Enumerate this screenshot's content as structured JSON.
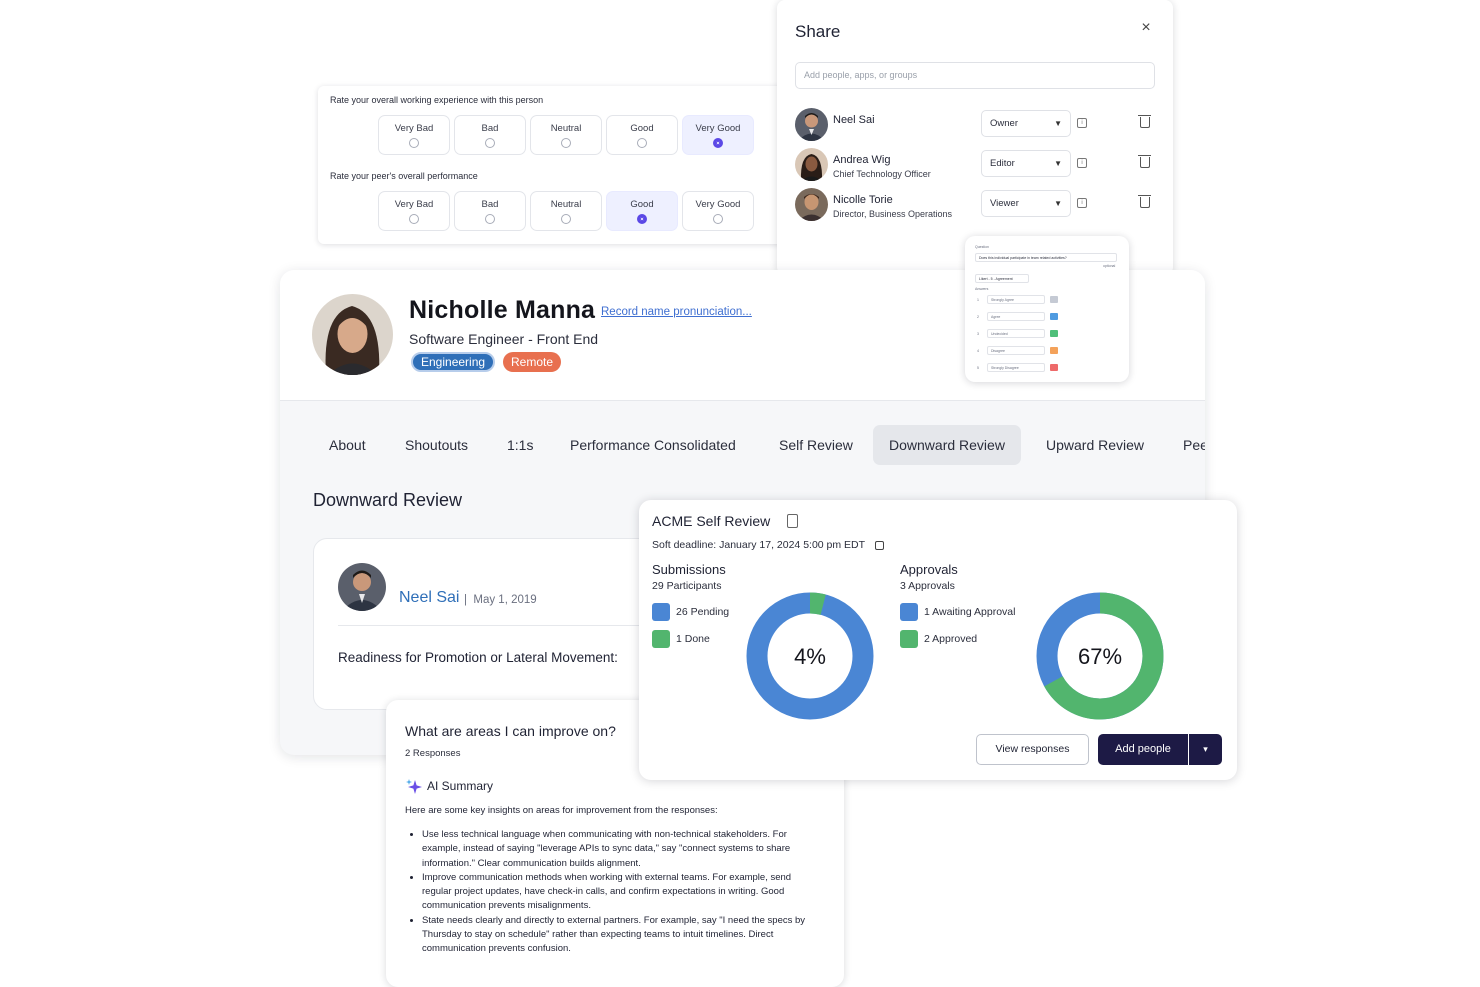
{
  "rating": {
    "questions": [
      {
        "label": "Rate your overall working experience with this person",
        "options": [
          "Very Bad",
          "Bad",
          "Neutral",
          "Good",
          "Very Good"
        ],
        "selected": 4
      },
      {
        "label": "Rate your peer's overall performance",
        "options": [
          "Very Bad",
          "Bad",
          "Neutral",
          "Good",
          "Very Good"
        ],
        "selected": 3
      }
    ]
  },
  "share": {
    "title": "Share",
    "close_icon": "close-icon",
    "placeholder": "Add people, apps, or groups",
    "people": [
      {
        "name": "Neel Sai",
        "role": "",
        "permission": "Owner"
      },
      {
        "name": "Andrea Wig",
        "role": "Chief Technology Officer",
        "permission": "Editor"
      },
      {
        "name": "Nicolle Torie",
        "role": "Director, Business Operations",
        "permission": "Viewer"
      }
    ]
  },
  "profile": {
    "name": "Nicholle Manna",
    "pronunciation_link": "Record name pronunciation...",
    "title": "Software Engineer - Front End",
    "tags": [
      "Engineering",
      "Remote"
    ],
    "tag_colors": {
      "engineering": "#2f6fb8",
      "remote": "#e8704f"
    }
  },
  "tabs": [
    "About",
    "Shoutouts",
    "1:1s",
    "Performance Consolidated",
    "Self Review",
    "Downward Review",
    "Upward Review",
    "Pee"
  ],
  "active_tab": "Downward Review",
  "section": {
    "title": "Downward Review",
    "review": {
      "reviewer": "Neel Sai",
      "separator": "|",
      "date": "May 1, 2019",
      "question": "Readiness for Promotion or Lateral Movement:"
    }
  },
  "preview": {
    "question_label": "Question",
    "question_text": "Does this individual participate in team related activities?",
    "optional": "optional",
    "scale": "Likert - 5 - Agreement",
    "answers_label": "Answers",
    "answers": [
      {
        "n": "1",
        "label": "Strongly Agree",
        "color": "#c5cad4"
      },
      {
        "n": "2",
        "label": "Agree",
        "color": "#4f9be0"
      },
      {
        "n": "3",
        "label": "Undecided",
        "color": "#4fbf7a"
      },
      {
        "n": "4",
        "label": "Disagree",
        "color": "#f4a25a"
      },
      {
        "n": "5",
        "label": "Strongly Disagree",
        "color": "#ee6a6a"
      }
    ]
  },
  "summary": {
    "title": "What are areas I can improve on?",
    "count": "2 Responses",
    "ai_label": "AI Summary",
    "intro": "Here are some key insights on areas for improvement from the responses:",
    "items": [
      "Use less technical language when communicating with non-technical stakeholders. For example, instead of saying \"leverage APIs to sync data,\" say \"connect systems to share information.\" Clear communication builds alignment.",
      "Improve communication methods when working with external teams. For example, send regular project updates, have check-in calls, and confirm expectations in writing. Good communication prevents misalignments.",
      "State needs clearly and directly to external partners. For example, say \"I need the specs by Thursday to stay on schedule\" rather than expecting teams to intuit timelines. Direct communication prevents confusion."
    ]
  },
  "acme": {
    "title": "ACME Self Review",
    "deadline": "Soft deadline: January 17, 2024 5:00 pm EDT",
    "submissions": {
      "title": "Submissions",
      "subtitle": "29 Participants",
      "legend": [
        {
          "label": "26 Pending",
          "color": "#4a86d4"
        },
        {
          "label": "1 Done",
          "color": "#52b56e"
        }
      ],
      "percent_label": "4%",
      "done_fraction": 0.04
    },
    "approvals": {
      "title": "Approvals",
      "subtitle": "3 Approvals",
      "legend": [
        {
          "label": "1 Awaiting Approval",
          "color": "#4a86d4"
        },
        {
          "label": "2 Approved",
          "color": "#52b56e"
        }
      ],
      "percent_label": "67%",
      "done_fraction": 0.67
    },
    "view_label": "View responses",
    "add_label": "Add people",
    "add_caret": "▾"
  }
}
